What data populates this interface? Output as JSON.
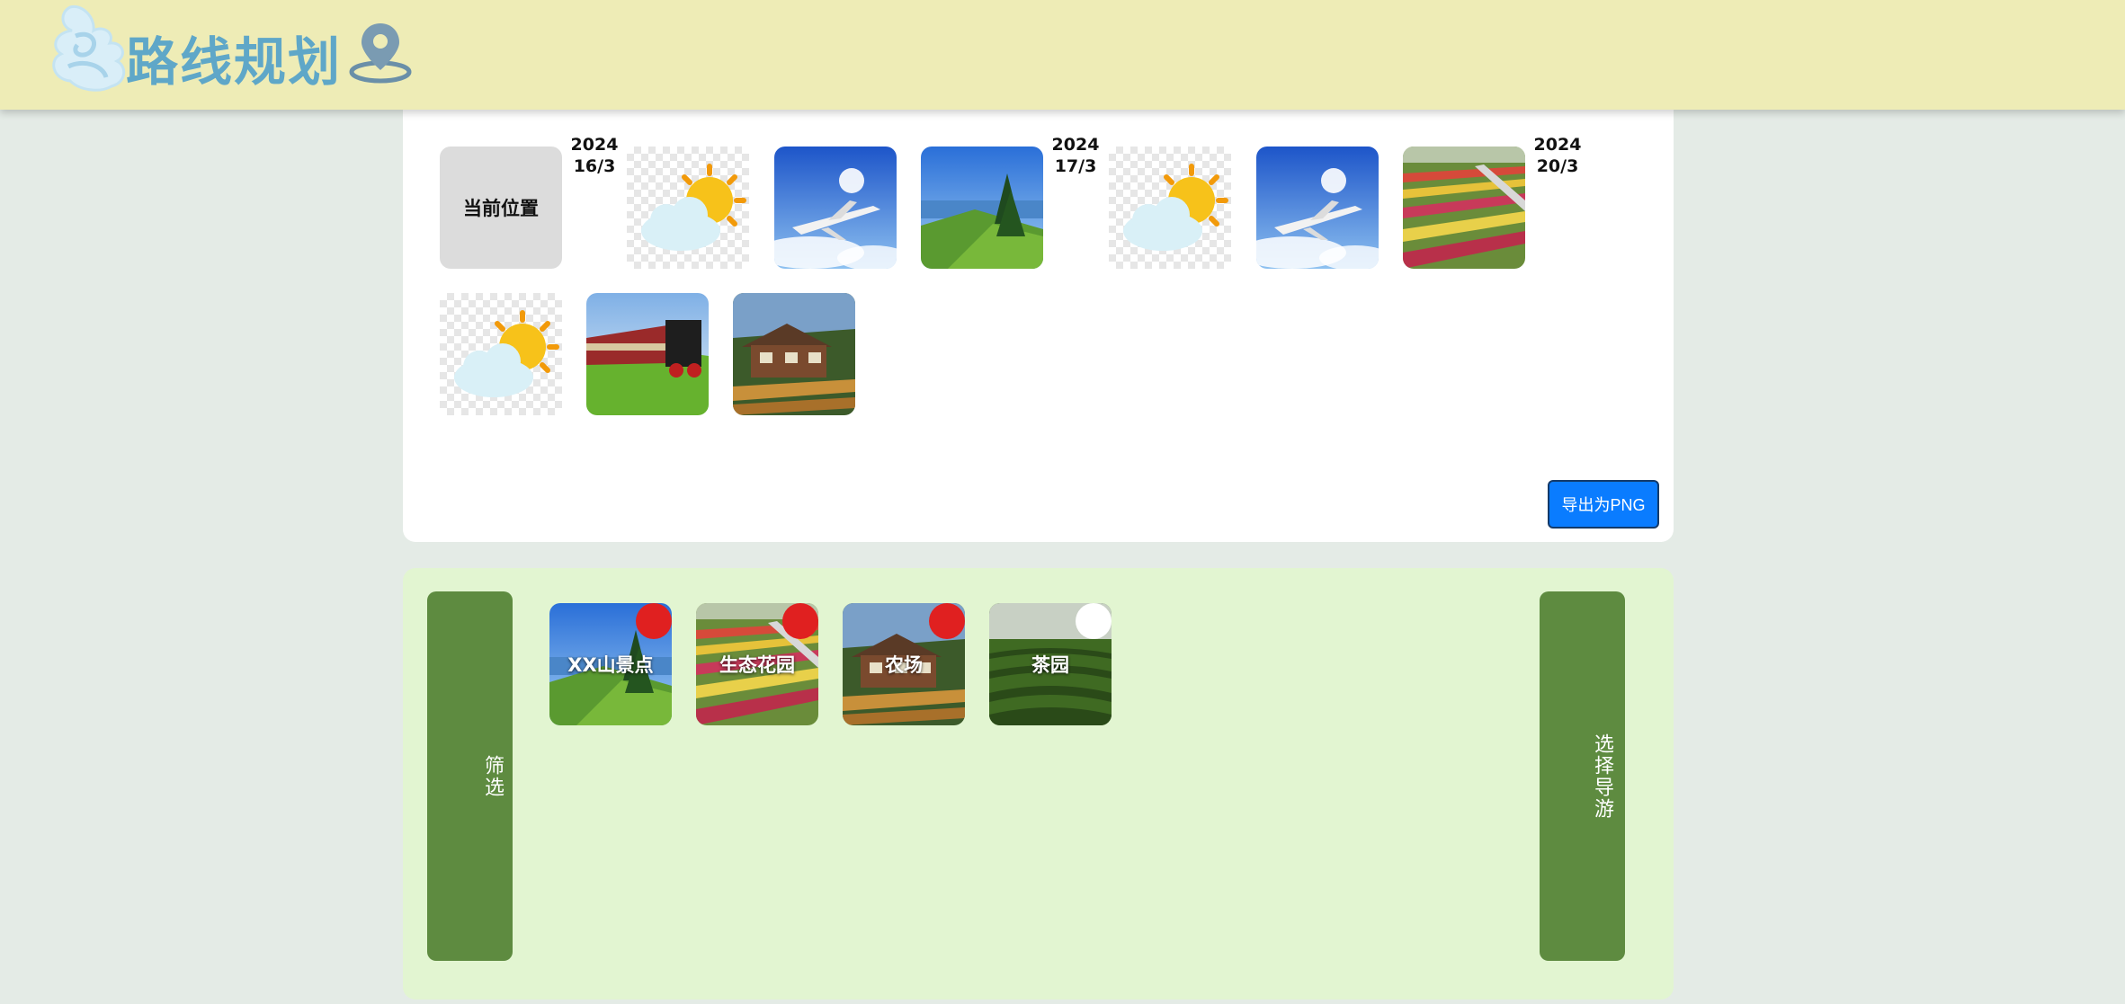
{
  "header": {
    "title": "路线规划",
    "logo_icon": "cloud-logo-icon",
    "pin_icon": "map-pin-icon"
  },
  "route": {
    "current_location_label": "当前位置",
    "day1": {
      "year": "2024",
      "date": "16/3"
    },
    "day2": {
      "year": "2024",
      "date": "17/3"
    },
    "day3": {
      "year": "2024",
      "date": "20/3"
    },
    "items": [
      "weather-sunny-cloud",
      "airplane",
      "mountain-lake",
      "weather-sunny-cloud",
      "airplane",
      "flower-field",
      "weather-sunny-cloud",
      "train",
      "farm-lodge"
    ],
    "export_label": "导出为PNG"
  },
  "spots": {
    "filter_label": "筛选",
    "guide_label": "选择导游",
    "items": [
      {
        "label": "XX山景点",
        "selected": true
      },
      {
        "label": "生态花园",
        "selected": true
      },
      {
        "label": "农场",
        "selected": true
      },
      {
        "label": "茶园",
        "selected": false
      }
    ]
  },
  "colors": {
    "header_bg": "#eeecb6",
    "page_bg": "#e4ebe6",
    "spot_panel_bg": "#e2f5d1",
    "side_button": "#5e8b40",
    "export_button": "#0a7cff",
    "selected_dot": "#e02020",
    "unselected_dot": "#ffffff"
  }
}
